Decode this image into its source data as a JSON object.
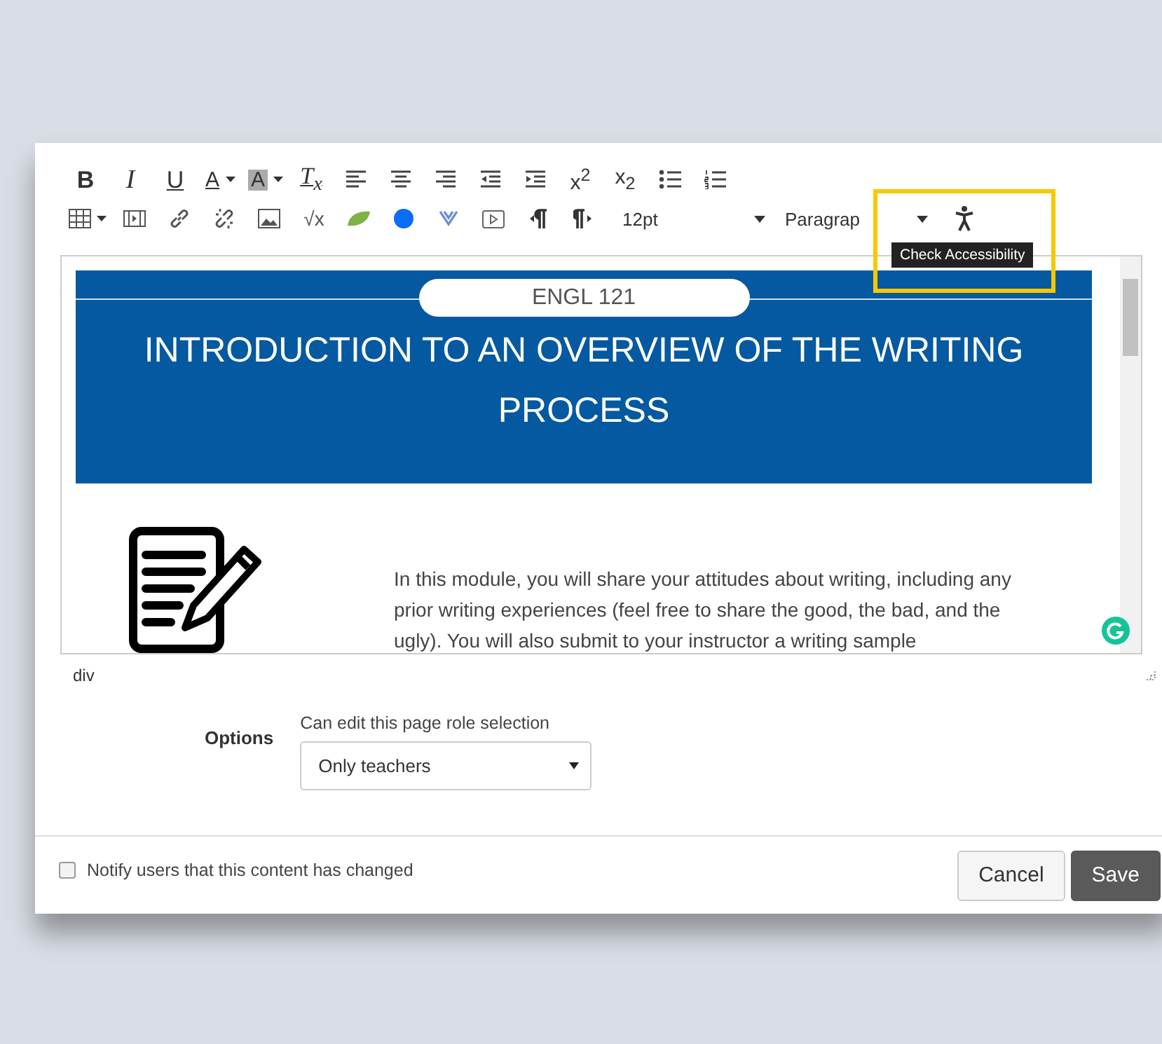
{
  "toolbar": {
    "rows": [
      [
        {
          "kind": "bold",
          "label": "B"
        },
        {
          "kind": "italic",
          "label": "I"
        },
        {
          "kind": "underline",
          "label": "U"
        },
        {
          "kind": "text-color",
          "label": "A",
          "has_caret": true
        },
        {
          "kind": "bg-color",
          "label": "A",
          "has_caret": true
        },
        {
          "kind": "clear-format",
          "label": "T$_{x}$"
        },
        {
          "kind": "align-left"
        },
        {
          "kind": "align-center"
        },
        {
          "kind": "align-right"
        },
        {
          "kind": "outdent"
        },
        {
          "kind": "indent"
        },
        {
          "kind": "script",
          "label": "x$^{2}$"
        },
        {
          "kind": "script",
          "label": "x$_{2}$"
        },
        {
          "kind": "bullet-list"
        },
        {
          "kind": "numbered-list"
        }
      ],
      [
        {
          "kind": "table",
          "has_caret": true
        },
        {
          "kind": "media"
        },
        {
          "kind": "link"
        },
        {
          "kind": "unlink"
        },
        {
          "kind": "image"
        },
        {
          "kind": "math",
          "label": "√x"
        },
        {
          "kind": "leaf"
        },
        {
          "kind": "circle"
        },
        {
          "kind": "chevron"
        },
        {
          "kind": "video"
        },
        {
          "kind": "ltr"
        },
        {
          "kind": "rtl"
        }
      ]
    ],
    "font_size": "12pt",
    "block_format": "Paragrap",
    "tooltip": "Check Accessibility",
    "highlighted": true
  },
  "editor": {
    "course_label": "ENGL 121",
    "heading": "INTRODUCTION TO AN OVERVIEW OF THE WRITING PROCESS",
    "paragraph": "In this module, you will share your attitudes about writing, including any prior writing experiences (feel free to share the good, the bad, and the ugly). You will also submit to your instructor a writing sample"
  },
  "status_path": "div",
  "options": {
    "label": "Options",
    "field_label": "Can edit this page role selection",
    "value": "Only teachers"
  },
  "notify": {
    "label": "Notify users that this content has changed",
    "checked": false
  },
  "buttons": [
    {
      "label": "Cancel",
      "kind": "secondary"
    },
    {
      "label": "Save",
      "kind": "primary"
    }
  ]
}
